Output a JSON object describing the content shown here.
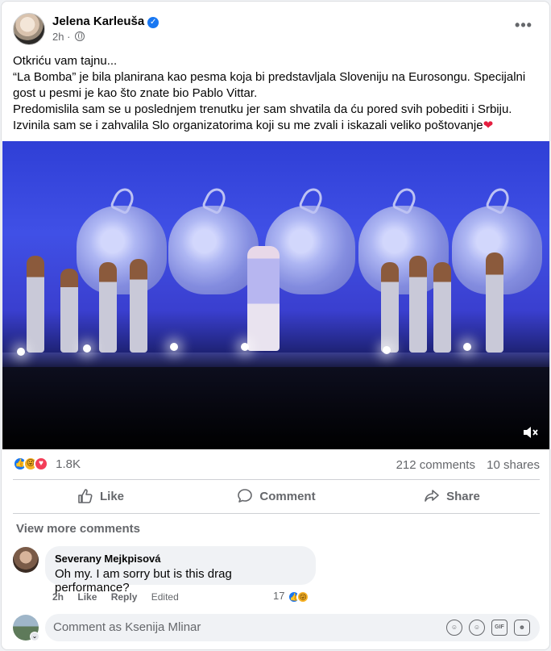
{
  "post": {
    "author": "Jelena Karleuša",
    "verified": true,
    "time": "2h",
    "audience_icon": "globe-icon",
    "text_lines": [
      "Otkriću vam tajnu...",
      "“La Bomba” je bila planirana kao pesma koja bi predstavljala Sloveniju na Eurosongu. Specijalni gost u pesmi je kao što znate bio Pablo Vittar.",
      "Predomislila sam se u poslednjem trenutku jer sam shvatila da ću pored svih pobediti i Srbiju.",
      "Izvinila sam se i zahvalila Slo organizatorima koji su me zvali i iskazali veliko poštovanje"
    ],
    "text_emoji": "❤"
  },
  "stats": {
    "reaction_count": "1.8K",
    "reactions": [
      "like",
      "haha",
      "love"
    ],
    "comments": "212 comments",
    "shares": "10 shares"
  },
  "actions": {
    "like": "Like",
    "comment": "Comment",
    "share": "Share"
  },
  "comments_section": {
    "view_more": "View more comments",
    "comment": {
      "author": "Severany Mejkpisová",
      "text": "Oh my. I am sorry but is this drag performance?",
      "time": "2h",
      "like": "Like",
      "reply": "Reply",
      "edited": "Edited",
      "reaction_count": "17"
    }
  },
  "composer": {
    "placeholder": "Comment as Ksenija Mlinar",
    "icons": [
      "sticker-avatar-icon",
      "emoji-icon",
      "gif-icon",
      "sticker-icon"
    ]
  },
  "colors": {
    "accent": "#1877f2",
    "love": "#f33e58",
    "haha": "#f7b125",
    "muted_text": "#65676b"
  }
}
